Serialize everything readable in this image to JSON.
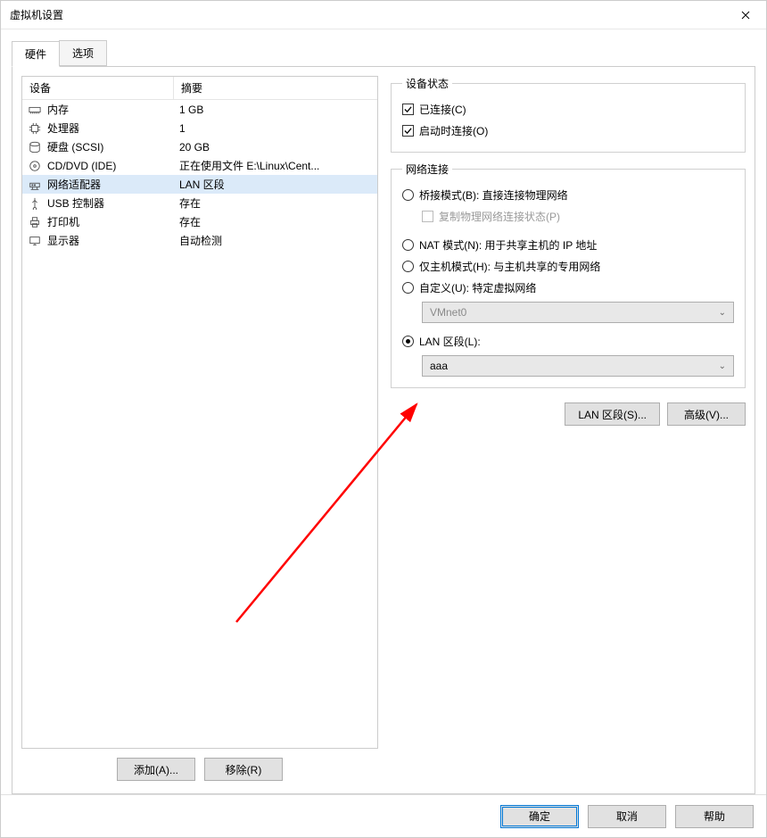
{
  "window_title": "虚拟机设置",
  "tabs": {
    "hardware": "硬件",
    "options": "选项"
  },
  "device_list": {
    "col_device": "设备",
    "col_summary": "摘要",
    "rows": [
      {
        "icon": "memory-icon",
        "name": "内存",
        "summary": "1 GB"
      },
      {
        "icon": "cpu-icon",
        "name": "处理器",
        "summary": "1"
      },
      {
        "icon": "disk-icon",
        "name": "硬盘 (SCSI)",
        "summary": "20 GB"
      },
      {
        "icon": "cd-icon",
        "name": "CD/DVD (IDE)",
        "summary": "正在使用文件 E:\\Linux\\Cent..."
      },
      {
        "icon": "network-icon",
        "name": "网络适配器",
        "summary": "LAN 区段",
        "selected": true
      },
      {
        "icon": "usb-icon",
        "name": "USB 控制器",
        "summary": "存在"
      },
      {
        "icon": "printer-icon",
        "name": "打印机",
        "summary": "存在"
      },
      {
        "icon": "display-icon",
        "name": "显示器",
        "summary": "自动检测"
      }
    ]
  },
  "left_buttons": {
    "add": "添加(A)...",
    "remove": "移除(R)"
  },
  "device_state": {
    "legend": "设备状态",
    "connected": "已连接(C)",
    "connect_on_start": "启动时连接(O)"
  },
  "network": {
    "legend": "网络连接",
    "bridged": "桥接模式(B): 直接连接物理网络",
    "replicate": "复制物理网络连接状态(P)",
    "nat": "NAT 模式(N): 用于共享主机的 IP 地址",
    "hostonly": "仅主机模式(H): 与主机共享的专用网络",
    "custom": "自定义(U): 特定虚拟网络",
    "custom_value": "VMnet0",
    "lansegment": "LAN 区段(L):",
    "lansegment_value": "aaa"
  },
  "right_buttons": {
    "lan_segments": "LAN 区段(S)...",
    "advanced": "高级(V)..."
  },
  "bottom": {
    "ok": "确定",
    "cancel": "取消",
    "help": "帮助"
  }
}
